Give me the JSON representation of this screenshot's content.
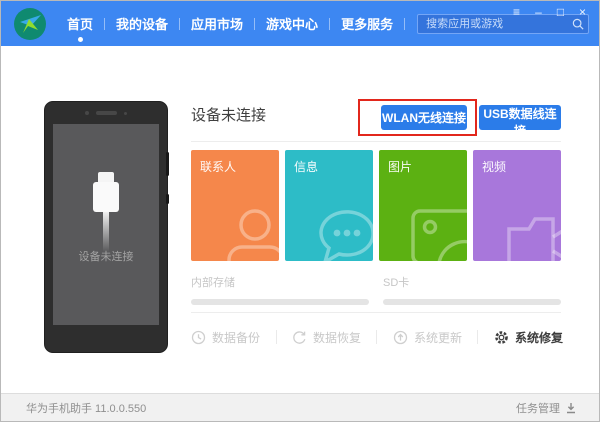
{
  "header": {
    "nav": [
      {
        "label": "首页",
        "active": true
      },
      {
        "label": "我的设备",
        "active": false
      },
      {
        "label": "应用市场",
        "active": false
      },
      {
        "label": "游戏中心",
        "active": false
      },
      {
        "label": "更多服务",
        "active": false
      }
    ],
    "search_placeholder": "搜索应用或游戏",
    "window_controls": {
      "menu": "≡",
      "minimize": "–",
      "maximize": "□",
      "close": "×"
    }
  },
  "phone": {
    "status_text": "设备未连接"
  },
  "main": {
    "title": "设备未连接",
    "buttons": [
      {
        "label": "WLAN无线连接",
        "highlighted": true
      },
      {
        "label": "USB数据线连接",
        "highlighted": false
      }
    ],
    "tiles": [
      {
        "label": "联系人",
        "color": "#f5874b",
        "icon": "contact-icon"
      },
      {
        "label": "信息",
        "color": "#2dbcc7",
        "icon": "message-icon"
      },
      {
        "label": "图片",
        "color": "#5cb112",
        "icon": "picture-icon"
      },
      {
        "label": "视频",
        "color": "#a877db",
        "icon": "video-icon"
      }
    ],
    "storage": [
      {
        "label": "内部存储"
      },
      {
        "label": "SD卡"
      }
    ],
    "actions": [
      {
        "label": "数据备份",
        "enabled": false
      },
      {
        "label": "数据恢复",
        "enabled": false
      },
      {
        "label": "系统更新",
        "enabled": false
      },
      {
        "label": "系统修复",
        "enabled": true
      }
    ]
  },
  "footer": {
    "version": "华为手机助手 11.0.0.550",
    "task_label": "任务管理"
  },
  "colors": {
    "header_blue": "#3d87f2",
    "button_blue": "#2b7ce9",
    "highlight_red": "#e2271c"
  }
}
